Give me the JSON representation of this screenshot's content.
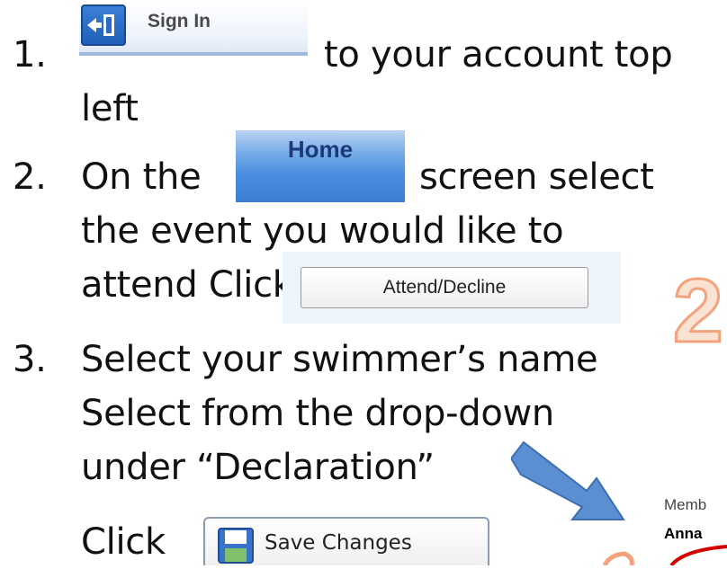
{
  "steps": [
    {
      "number": "1.",
      "text_after_button": "to your account top",
      "text_line2": "left"
    },
    {
      "number": "2.",
      "text_before": "On the",
      "text_after_button": "screen select",
      "text_line2": "the event you would like to",
      "text_line3": "attend Click"
    },
    {
      "number": "3.",
      "line1": "Select your swimmer’s name",
      "line2": "Select from the drop-down",
      "line3": "under “Declaration”"
    }
  ],
  "click_label": "Click",
  "buttons": {
    "sign_in": "Sign In",
    "home": "Home",
    "attend_decline": "Attend/Decline",
    "save_changes": "Save Changes"
  },
  "callout_number": "2",
  "cropped_fragments": {
    "member": "Memb",
    "name": "Anna"
  },
  "colors": {
    "accent_orange": "#f3a37c",
    "arrow_blue": "#5b8fd1",
    "home_blue": "#4a8fe0",
    "red": "#d40000"
  }
}
